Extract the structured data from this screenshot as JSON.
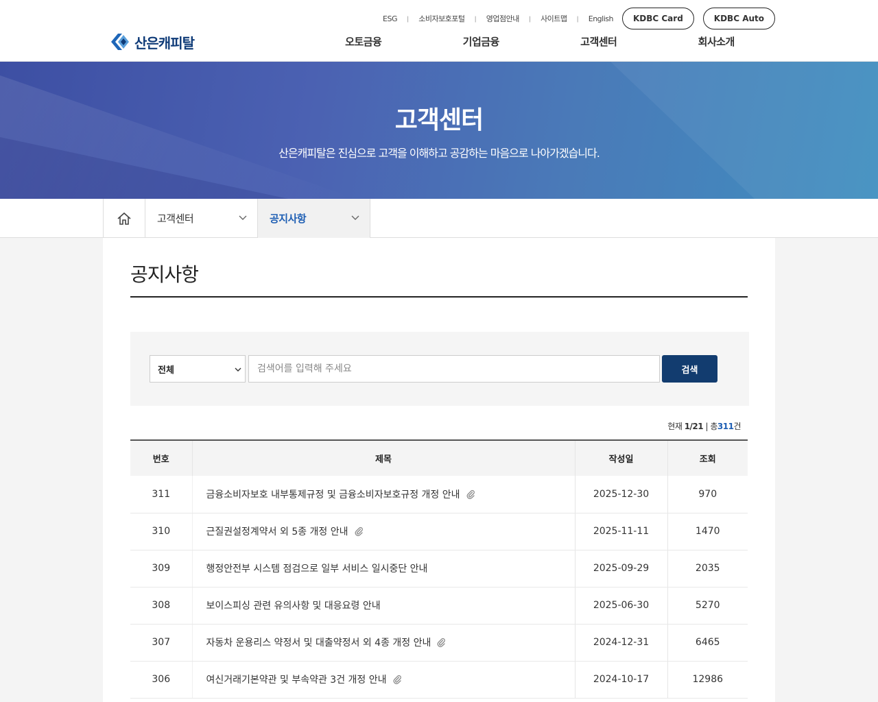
{
  "header": {
    "util_links": [
      "ESG",
      "소비자보호포털",
      "영업점안내",
      "사이트맵",
      "English"
    ],
    "pills": [
      "KDBC Card",
      "KDBC Auto"
    ],
    "logo_text": "산은캐피탈",
    "gnb": [
      "오토금융",
      "기업금융",
      "고객센터",
      "회사소개"
    ]
  },
  "hero": {
    "title": "고객센터",
    "subtitle": "산은캐피탈은 진심으로 고객을 이해하고 공감하는 마음으로 나아가겠습니다."
  },
  "location": {
    "depth1": "고객센터",
    "depth2": "공지사항"
  },
  "page": {
    "title": "공지사항"
  },
  "search": {
    "category": "전체",
    "placeholder": "검색어를 입력해 주세요",
    "button": "검색"
  },
  "count": {
    "prefix": "현재",
    "page": "1/21",
    "sep": "|",
    "total_label": "총",
    "total": "311",
    "suffix": "건"
  },
  "table": {
    "headers": [
      "번호",
      "제목",
      "작성일",
      "조회"
    ],
    "rows": [
      {
        "num": "311",
        "title": "금융소비자보호 내부통제규정 및 금융소비자보호규정 개정 안내",
        "attach": true,
        "date": "2025-12-30",
        "views": "970"
      },
      {
        "num": "310",
        "title": "근질권설정계약서 외 5종 개정 안내",
        "attach": true,
        "date": "2025-11-11",
        "views": "1470"
      },
      {
        "num": "309",
        "title": "행정안전부 시스템 점검으로 일부 서비스 일시중단 안내",
        "attach": false,
        "date": "2025-09-29",
        "views": "2035"
      },
      {
        "num": "308",
        "title": "보이스피싱 관련 유의사항 및 대응요령 안내",
        "attach": false,
        "date": "2025-06-30",
        "views": "5270"
      },
      {
        "num": "307",
        "title": "자동차 운용리스 약정서 및 대출약정서 외 4종 개정 안내",
        "attach": true,
        "date": "2024-12-31",
        "views": "6465"
      },
      {
        "num": "306",
        "title": "여신거래기본약관 및 부속약관 3건 개정 안내",
        "attach": true,
        "date": "2024-10-17",
        "views": "12986"
      }
    ]
  },
  "colors": {
    "brand_navy": "#0f3b78",
    "button_navy": "#123c6f",
    "accent_blue": "#1f5fb4"
  }
}
